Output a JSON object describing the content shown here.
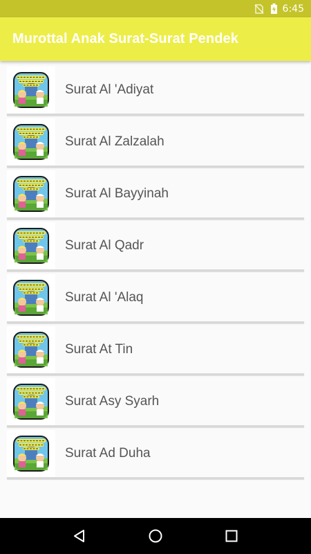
{
  "status_bar": {
    "time": "6:45",
    "icons": [
      "no-sim-icon",
      "battery-charging-icon"
    ],
    "background_color": "#c4c42a"
  },
  "app_bar": {
    "title": "Murottal Anak Surat-Surat Pendek",
    "background_color": "#eded48"
  },
  "surah_list": {
    "thumbnail_icon": "murottal-anak-app-icon",
    "items": [
      {
        "label": "Surat Al 'Adiyat"
      },
      {
        "label": "Surat Al Zalzalah"
      },
      {
        "label": "Surat Al Bayyinah"
      },
      {
        "label": "Surat Al Qadr"
      },
      {
        "label": "Surat Al 'Alaq"
      },
      {
        "label": "Surat At Tin"
      },
      {
        "label": "Surat Asy Syarh"
      },
      {
        "label": "Surat Ad Duha"
      }
    ]
  },
  "nav_bar": {
    "buttons": [
      "back-icon",
      "home-icon",
      "recents-icon"
    ]
  }
}
